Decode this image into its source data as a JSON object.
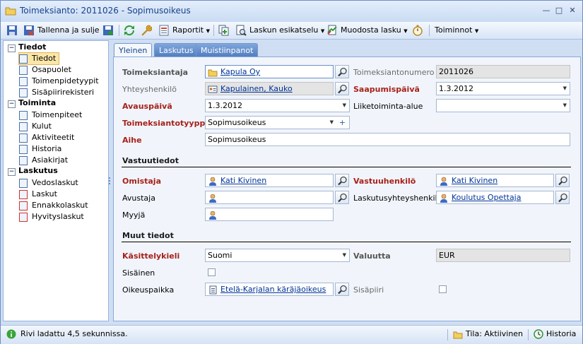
{
  "window": {
    "title": "Toimeksianto: 2011026 - Sopimusoikeus"
  },
  "toolbar": {
    "save_close": "Tallenna ja sulje",
    "reports": "Raportit",
    "invoice_preview": "Laskun esikatselu",
    "create_invoice": "Muodosta lasku",
    "actions": "Toiminnot"
  },
  "nav": {
    "groups": [
      {
        "label": "Tiedot",
        "items": [
          "Tiedot",
          "Osapuolet",
          "Toimenpidetyypit",
          "Sisäpiirirekisteri"
        ]
      },
      {
        "label": "Toiminta",
        "items": [
          "Toimenpiteet",
          "Kulut",
          "Aktiviteetit",
          "Historia",
          "Asiakirjat"
        ]
      },
      {
        "label": "Laskutus",
        "items": [
          "Vedoslaskut",
          "Laskut",
          "Ennakkolaskut",
          "Hyvityslaskut"
        ]
      }
    ],
    "selected": "Tiedot"
  },
  "tabs": [
    "Yleinen",
    "Laskutus",
    "Muistiinpanot"
  ],
  "form": {
    "client_label": "Toimeksiantaja",
    "client_value": "Kapula Oy",
    "number_label": "Toimeksiantonumero",
    "number_value": "2011026",
    "contact_label": "Yhteyshenkilö",
    "contact_value": "Kapulainen, Kauko",
    "arrival_label": "Saapumispäivä",
    "arrival_value": "1.3.2012",
    "opening_label": "Avauspäivä",
    "opening_value": "1.3.2012",
    "business_label": "Liiketoiminta-alue",
    "business_value": "",
    "type_label": "Toimeksiantotyyppi",
    "type_value": "Sopimusoikeus",
    "subject_label": "Aihe",
    "subject_value": "Sopimusoikeus",
    "resp_section": "Vastuutiedot",
    "owner_label": "Omistaja",
    "owner_value": "Kati Kivinen",
    "responsible_label": "Vastuuhenkilö",
    "responsible_value": "Kati Kivinen",
    "assistant_label": "Avustaja",
    "assistant_value": "",
    "billing_contact_label": "Laskutusyhteyshenkilö",
    "billing_contact_value": "Koulutus Opettaja",
    "seller_label": "Myyjä",
    "seller_value": "",
    "other_section": "Muut tiedot",
    "language_label": "Käsittelykieli",
    "language_value": "Suomi",
    "currency_label": "Valuutta",
    "currency_value": "EUR",
    "internal_label": "Sisäinen",
    "court_label": "Oikeuspaikka",
    "court_value": "Etelä-Karjalan käräjäoikeus",
    "insider_label": "Sisäpiiri"
  },
  "status": {
    "message": "Rivi ladattu 4,5 sekunnissa.",
    "state": "Tila: Aktiivinen",
    "history": "Historia"
  }
}
